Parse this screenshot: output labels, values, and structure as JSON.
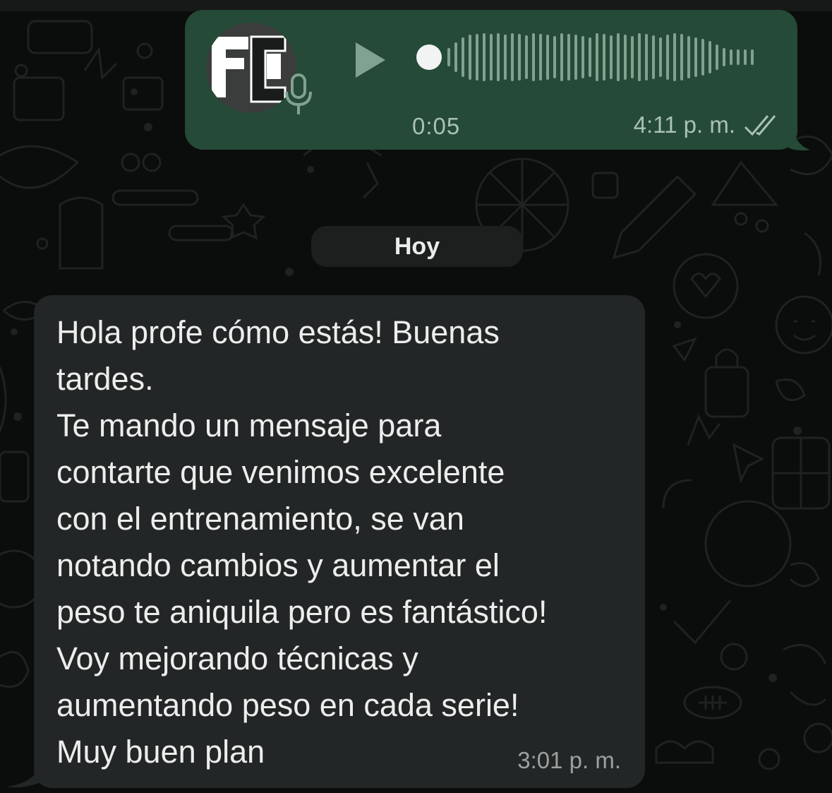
{
  "voice_message": {
    "duration": "0:05",
    "timestamp": "4:11 p. m.",
    "status_icon": "double-check-icon",
    "avatar_icon": "profile-logo-icon",
    "bubble_color": "#254a37"
  },
  "date_separator": {
    "label": "Hoy"
  },
  "text_message": {
    "lines": [
      "Hola profe cómo estás! Buenas",
      "tardes.",
      "Te mando un mensaje para",
      "contarte que venimos excelente",
      "con el entrenamiento, se van",
      "notando cambios y aumentar el",
      "peso te aniquila pero es fantástico!",
      "Voy mejorando técnicas y",
      "aumentando peso en cada serie!",
      "Muy buen plan"
    ],
    "timestamp": "3:01 p. m.",
    "bubble_color": "#232626"
  }
}
